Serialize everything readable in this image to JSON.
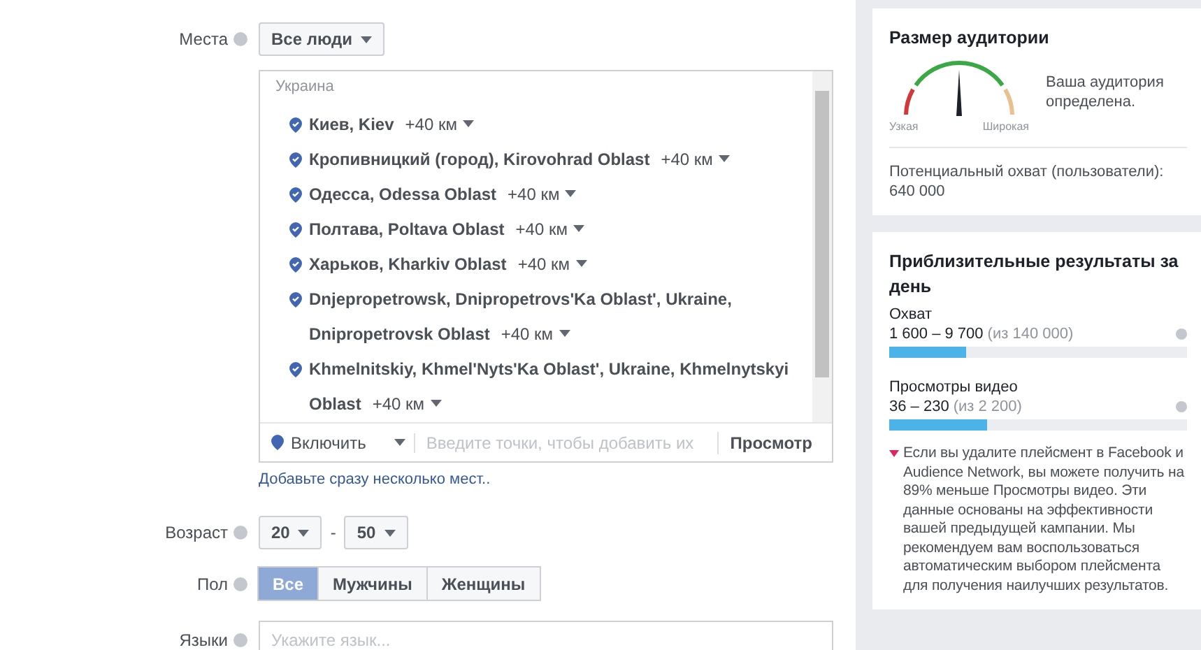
{
  "targeting": {
    "places": {
      "label": "Места",
      "dropdown": "Все люди",
      "group": "Украина",
      "locations": [
        {
          "name": "Киев, Kiev",
          "radius": "+40 км"
        },
        {
          "name": "Кропивницкий (город), Kirovohrad Oblast",
          "radius": "+40 км"
        },
        {
          "name": "Одесса, Odessa Oblast",
          "radius": "+40 км"
        },
        {
          "name": "Полтава, Poltava Oblast",
          "radius": "+40 км"
        },
        {
          "name": "Харьков, Kharkiv Oblast",
          "radius": "+40 км"
        },
        {
          "name": "Dnjepropetrowsk, Dnipropetrovs'Ka Oblast', Ukraine,",
          "name_continued": "Dnipropetrovsk Oblast",
          "radius": "+40 км"
        },
        {
          "name": "Khmelnitskiy, Khmel'Nyts'Ka Oblast', Ukraine, Khmelnytskyi",
          "name_continued": "Oblast",
          "radius": "+40 км"
        }
      ],
      "include": "Включить",
      "input_placeholder": "Введите точки, чтобы добавить их",
      "browse": "Просмотр",
      "bulk_link": "Добавьте сразу несколько мест.."
    },
    "age": {
      "label": "Возраст",
      "from": "20",
      "separator": "-",
      "to": "50"
    },
    "gender": {
      "label": "Пол",
      "options": [
        {
          "label": "Все",
          "selected": true
        },
        {
          "label": "Мужчины",
          "selected": false
        },
        {
          "label": "Женщины",
          "selected": false
        }
      ]
    },
    "languages": {
      "label": "Языки",
      "placeholder": "Укажите язык..."
    }
  },
  "audience": {
    "title": "Размер аудитории",
    "narrow": "Узкая",
    "wide": "Широкая",
    "status": "Ваша аудитория определена.",
    "reach_label": "Потенциальный охват (пользователи):",
    "reach_value": "640 000"
  },
  "estimates": {
    "title": "Приблизительные результаты за день",
    "metrics": [
      {
        "name": "Охват",
        "range": "1 600 – 9 700",
        "total": "(из 140 000)",
        "level": 0.26
      },
      {
        "name": "Просмотры видео",
        "range": "36 – 230",
        "total": "(из 2 200)",
        "level": 0.33
      }
    ],
    "note": "Если вы удалите плейсмент в Facebook и Audience Network, вы можете получить на 89% меньше Просмотры видео. Эти данные основаны на эффективности вашей предыдущей кампании. Мы рекомендуем вам воспользоваться автоматическим выбором плейсмента для получения наилучших результатов."
  }
}
